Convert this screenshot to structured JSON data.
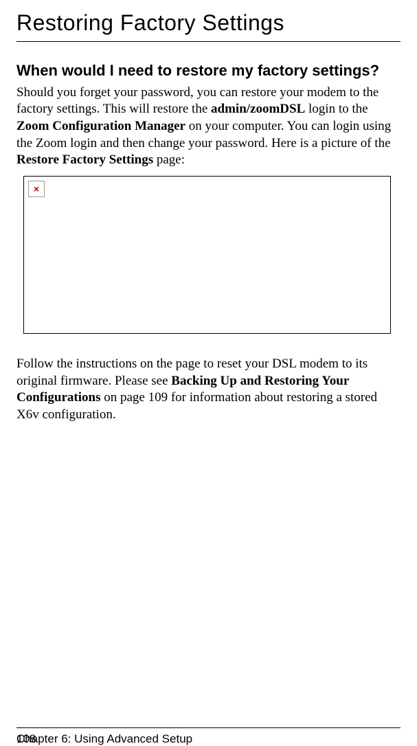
{
  "title": "Restoring Factory Settings",
  "subheading": "When would I need to restore my factory settings?",
  "para1": {
    "t1": "Should you forget your password, you can restore your modem to the factory settings. This will restore the ",
    "b1": "admin/zoomDSL",
    "t2": " login to the ",
    "b2": "Zoom Configuration Manager",
    "t3": " on your computer. You can login using the Zoom login and then change your password. Here is a picture of the ",
    "b3": "Restore Factory Settings",
    "t4": " page:"
  },
  "broken_icon": "×",
  "para2": {
    "t1": "Follow the instructions on the page to reset your DSL modem to its original firmware. Please see ",
    "b1": "Backing Up and Restoring Your Configurations",
    "t2": " on page 109 for information about restoring a stored X6v configuration."
  },
  "footer": {
    "page_num": "108",
    "chapter": "Chapter 6: Using Advanced Setup"
  }
}
